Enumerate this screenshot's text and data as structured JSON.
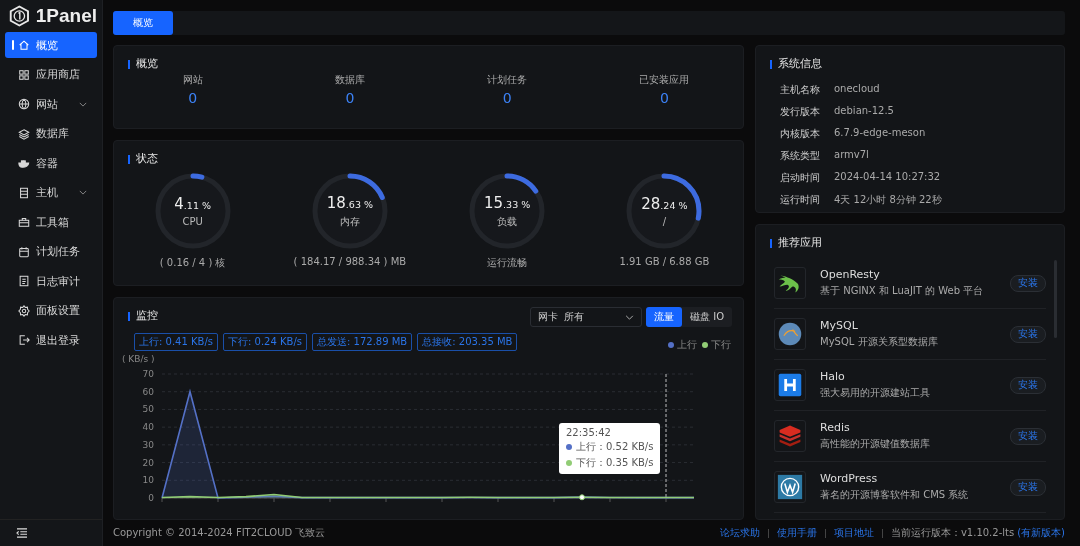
{
  "brand": {
    "name": "1Panel"
  },
  "sidebar": {
    "items": [
      {
        "label": "概览",
        "selected": true
      },
      {
        "label": "应用商店",
        "selected": false
      },
      {
        "label": "网站",
        "selected": false,
        "expanded": false
      },
      {
        "label": "数据库",
        "selected": false
      },
      {
        "label": "容器",
        "selected": false
      },
      {
        "label": "主机",
        "selected": false,
        "expanded": false
      },
      {
        "label": "工具箱",
        "selected": false
      },
      {
        "label": "计划任务",
        "selected": false
      },
      {
        "label": "日志审计",
        "selected": false
      },
      {
        "label": "面板设置",
        "selected": false
      },
      {
        "label": "退出登录",
        "selected": false
      }
    ]
  },
  "tabs": [
    {
      "label": "概览",
      "selected": true
    }
  ],
  "overview": {
    "title": "概览",
    "stats": [
      {
        "label": "网站",
        "value": "0"
      },
      {
        "label": "数据库",
        "value": "0"
      },
      {
        "label": "计划任务",
        "value": "0"
      },
      {
        "label": "已安装应用",
        "value": "0"
      }
    ]
  },
  "status": {
    "title": "状态",
    "gauges": [
      {
        "value": "4.11 %",
        "name": "CPU",
        "detail": "( 0.16 / 4 ) 核",
        "level": 0.0411
      },
      {
        "value": "18.63 %",
        "name": "内存",
        "detail": "( 184.17 / 988.34 ) MB",
        "level": 0.1863
      },
      {
        "value": "15.33 %",
        "name": "负载",
        "detail": "运行流畅",
        "level": 0.1533
      },
      {
        "value": "28.24 %",
        "name": "/",
        "detail": "1.91 GB / 6.88 GB",
        "level": 0.2824
      }
    ]
  },
  "monitor": {
    "title": "监控",
    "nic": {
      "label": "网卡",
      "value": "所有"
    },
    "toggles": [
      {
        "label": "流量",
        "selected": true
      },
      {
        "label": "磁盘 IO",
        "selected": false
      }
    ],
    "tags": [
      "上行: 0.41 KB/s",
      "下行: 0.24 KB/s",
      "总发送: 172.89 MB",
      "总接收: 203.35 MB"
    ],
    "chart_data": {
      "type": "area",
      "grid": true,
      "ylabel": "( KB/s )",
      "ylim": [
        0,
        70
      ],
      "yticks": [
        0,
        10,
        20,
        30,
        40,
        50,
        60,
        70
      ],
      "series": [
        {
          "name": "上行",
          "color": "#5470c6",
          "values": [
            0,
            60,
            0,
            0.5,
            1,
            0.2,
            0.2,
            0.2,
            0.2,
            0.2,
            0.2,
            0.3,
            0.2,
            0.2,
            0.2,
            0.5,
            0.3,
            0.2,
            0.2,
            0.2
          ]
        },
        {
          "name": "下行",
          "color": "#91cc75",
          "values": [
            0.3,
            0.8,
            0.3,
            0.8,
            2,
            0.3,
            0.3,
            0.3,
            0.3,
            0.3,
            0.3,
            0.4,
            0.3,
            0.3,
            0.3,
            0.4,
            0.3,
            0.3,
            0.3,
            0.3
          ]
        }
      ]
    },
    "tooltip": {
      "time": "22:35:42",
      "rows": [
        {
          "text": "上行：0.52 KB/s",
          "color": "#5470c6"
        },
        {
          "text": "下行：0.35 KB/s",
          "color": "#91cc75"
        }
      ]
    }
  },
  "system_info": {
    "title": "系统信息",
    "rows": [
      {
        "label": "主机名称",
        "value": "onecloud"
      },
      {
        "label": "发行版本",
        "value": "debian-12.5"
      },
      {
        "label": "内核版本",
        "value": "6.7.9-edge-meson"
      },
      {
        "label": "系统类型",
        "value": "armv7l"
      },
      {
        "label": "启动时间",
        "value": "2024-04-14 10:27:32"
      },
      {
        "label": "运行时间",
        "value": "4天 12小时 8分钟 22秒"
      }
    ]
  },
  "recommended_apps": {
    "title": "推荐应用",
    "apps": [
      {
        "name": "OpenResty",
        "description": "基于 NGINX 和 LuaJIT 的 Web 平台",
        "action": "安装"
      },
      {
        "name": "MySQL",
        "description": "MySQL 开源关系型数据库",
        "action": "安装"
      },
      {
        "name": "Halo",
        "description": "强大易用的开源建站工具",
        "action": "安装"
      },
      {
        "name": "Redis",
        "description": "高性能的开源键值数据库",
        "action": "安装"
      },
      {
        "name": "WordPress",
        "description": "著名的开源博客软件和 CMS 系统",
        "action": "安装"
      }
    ]
  },
  "footer": {
    "copyright": "Copyright © 2014-2024 FIT2CLOUD 飞致云",
    "links": [
      "论坛求助",
      "使用手册",
      "项目地址"
    ],
    "version": "当前运行版本：v1.10.2-lts",
    "update": "(有新版本)"
  }
}
